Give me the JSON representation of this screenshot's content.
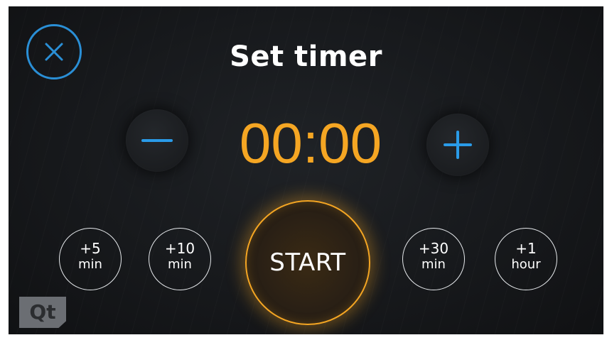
{
  "title": "Set timer",
  "time": "00:00",
  "start_label": "START",
  "quick_add": [
    {
      "amount": "+5",
      "unit": "min"
    },
    {
      "amount": "+10",
      "unit": "min"
    },
    {
      "amount": "+30",
      "unit": "min"
    },
    {
      "amount": "+1",
      "unit": "hour"
    }
  ],
  "logo": "Qt",
  "icons": {
    "close": "close-icon",
    "minus": "minus-icon",
    "plus": "plus-icon"
  },
  "colors": {
    "accent": "#f5a623",
    "blue": "#2a8fd6",
    "background": "#17191c"
  }
}
